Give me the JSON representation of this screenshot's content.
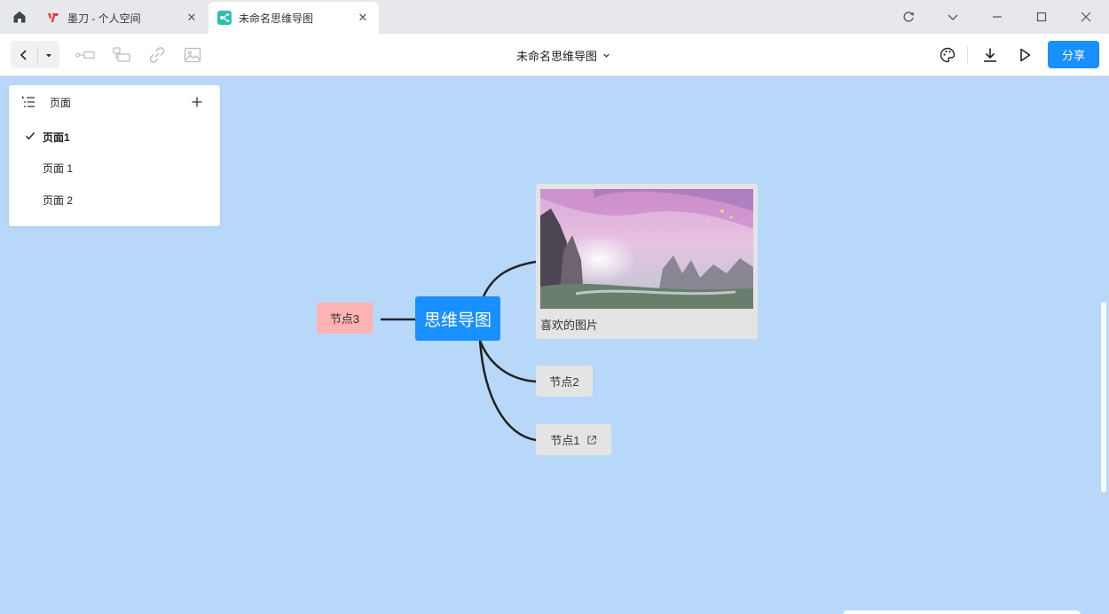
{
  "tabs": [
    {
      "label": "墨刀 - 个人空间",
      "favicon": "modao-logo-icon",
      "active": false
    },
    {
      "label": "未命名思维导图",
      "favicon": "mindmap-app-icon",
      "active": true
    }
  ],
  "window_controls": [
    "refresh-icon",
    "chevron-down-icon",
    "minimize-icon",
    "maximize-icon",
    "close-icon"
  ],
  "toolbar": {
    "doc_title": "未命名思维导图",
    "share_label": "分享",
    "left_icons": [
      "back-icon",
      "dropdown-caret-icon",
      "connector-icon",
      "summary-icon",
      "link-icon",
      "image-icon"
    ],
    "right_icons": [
      "palette-icon",
      "download-icon",
      "play-icon"
    ]
  },
  "page_panel": {
    "title": "页面",
    "pages": [
      {
        "label": "页面1",
        "active": true
      },
      {
        "label": "页面 1",
        "active": false
      },
      {
        "label": "页面 2",
        "active": false
      }
    ]
  },
  "mindmap": {
    "root": "思维导图",
    "left_node": "节点3",
    "image_node_label": "喜欢的图片",
    "node_2": "节点2",
    "node_1": "节点1"
  },
  "colors": {
    "canvas": "#b8d8fa",
    "accent": "#1890ff",
    "node_3_bg": "#ffb3b3",
    "node_bg": "#e4e4e4"
  }
}
